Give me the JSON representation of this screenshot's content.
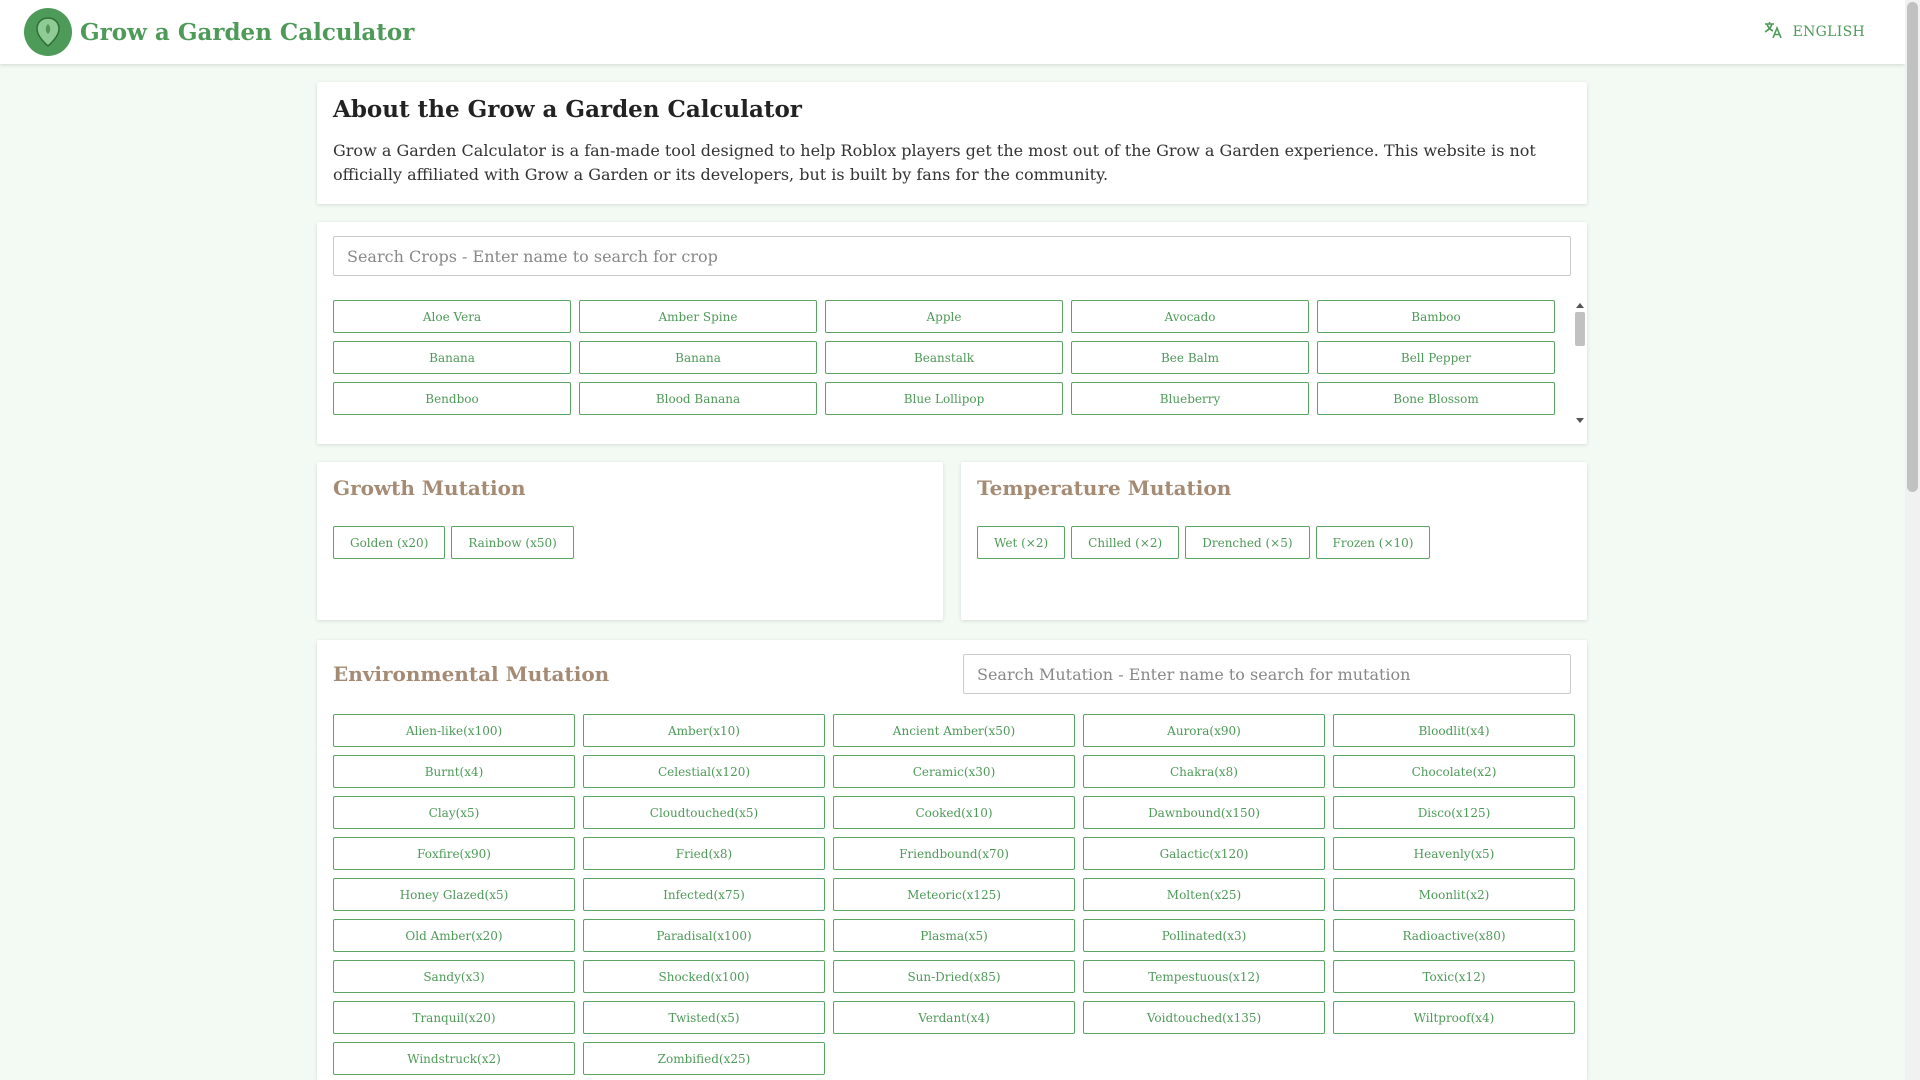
{
  "header": {
    "title": "Grow a Garden Calculator",
    "language": "ENGLISH",
    "logo_icon": "map-pin-icon",
    "language_icon": "translate-icon"
  },
  "colors": {
    "accent": "#4e9a58",
    "section_title": "#a58b74",
    "background": "#f3faf4"
  },
  "about": {
    "title": "About the Grow a Garden Calculator",
    "text": "Grow a Garden Calculator is a fan-made tool designed to help Roblox players get the most out of the Grow a Garden experience. This website is not officially affiliated with Grow a Garden or its developers, but is built by fans for the community."
  },
  "crops": {
    "placeholder": "Search Crops - Enter name to search for crop",
    "items": [
      "Aloe Vera",
      "Amber Spine",
      "Apple",
      "Avocado",
      "Bamboo",
      "Banana",
      "Banana",
      "Beanstalk",
      "Bee Balm",
      "Bell Pepper",
      "Bendboo",
      "Blood Banana",
      "Blue Lollipop",
      "Blueberry",
      "Bone Blossom"
    ]
  },
  "growth": {
    "title": "Growth Mutation",
    "items": [
      "Golden (x20)",
      "Rainbow (x50)"
    ]
  },
  "temperature": {
    "title": "Temperature Mutation",
    "items": [
      "Wet (×2)",
      "Chilled (×2)",
      "Drenched (×5)",
      "Frozen (×10)"
    ]
  },
  "environmental": {
    "title": "Environmental Mutation",
    "placeholder": "Search Mutation - Enter name to search for mutation",
    "items": [
      "Alien-like(x100)",
      "Amber(x10)",
      "Ancient Amber(x50)",
      "Aurora(x90)",
      "Bloodlit(x4)",
      "Burnt(x4)",
      "Celestial(x120)",
      "Ceramic(x30)",
      "Chakra(x8)",
      "Chocolate(x2)",
      "Clay(x5)",
      "Cloudtouched(x5)",
      "Cooked(x10)",
      "Dawnbound(x150)",
      "Disco(x125)",
      "Foxfire(x90)",
      "Fried(x8)",
      "Friendbound(x70)",
      "Galactic(x120)",
      "Heavenly(x5)",
      "Honey Glazed(x5)",
      "Infected(x75)",
      "Meteoric(x125)",
      "Molten(x25)",
      "Moonlit(x2)",
      "Old Amber(x20)",
      "Paradisal(x100)",
      "Plasma(x5)",
      "Pollinated(x3)",
      "Radioactive(x80)",
      "Sandy(x3)",
      "Shocked(x100)",
      "Sun-Dried(x85)",
      "Tempestuous(x12)",
      "Toxic(x12)",
      "Tranquil(x20)",
      "Twisted(x5)",
      "Verdant(x4)",
      "Voidtouched(x135)",
      "Wiltproof(x4)",
      "Windstruck(x2)",
      "Zombified(x25)"
    ]
  }
}
